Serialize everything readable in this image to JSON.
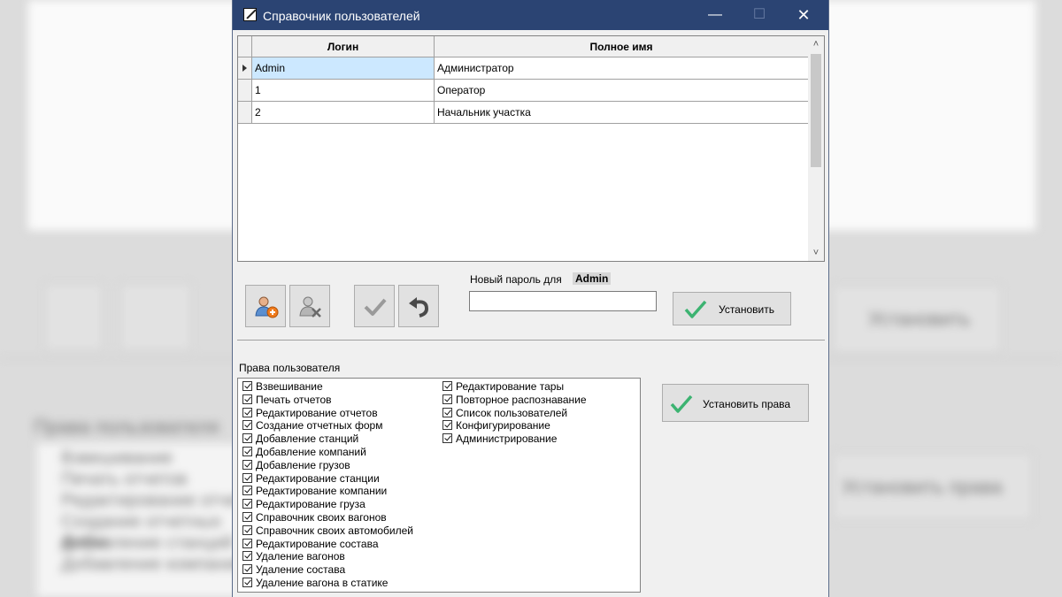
{
  "background": {
    "blurred_texts": [
      "Права пользователя",
      "Установить",
      "Установить права",
      "Взвешивание",
      "Печать отчетов",
      "Редактирование отчетов",
      "Создание отчетных форм",
      "Добавление станций",
      "Добавление компаний"
    ]
  },
  "window": {
    "title": "Справочник пользователей",
    "minimize_glyph": "—",
    "maximize_glyph": "☐",
    "close_glyph": "✕"
  },
  "grid": {
    "columns": [
      "Логин",
      "Полное имя"
    ],
    "rows": [
      {
        "login": "Admin",
        "full_name": "Администратор",
        "selected": true
      },
      {
        "login": "1",
        "full_name": "Оператор",
        "selected": false
      },
      {
        "login": "2",
        "full_name": "Начальник участка",
        "selected": false
      }
    ],
    "scroll_up": "˄",
    "scroll_down": "˅"
  },
  "toolbar": {
    "icons": [
      "add-user-icon",
      "delete-user-icon",
      "confirm-icon",
      "undo-icon"
    ]
  },
  "password": {
    "label": "Новый пароль для",
    "user": "Admin",
    "value": "",
    "set_button": "Установить"
  },
  "rights": {
    "title": "Права пользователя",
    "set_button": "Установить права",
    "left_column": [
      "Взвешивание",
      "Печать отчетов",
      "Редактирование отчетов",
      "Создание отчетных форм",
      "Добавление станций",
      "Добавление компаний",
      "Добавление грузов",
      "Редактирование станции",
      "Редактирование компании",
      "Редактирование груза",
      "Справочник своих вагонов",
      "Справочник своих автомобилей",
      "Редактирование состава",
      "Удаление вагонов",
      "Удаление состава",
      "Удаление вагона в статике"
    ],
    "right_column": [
      "Редактирование тары",
      "Повторное распознавание",
      "Список пользователей",
      "Конфигурирование",
      "Администрирование"
    ]
  },
  "colors": {
    "titlebar": "#2b4473",
    "selection": "#cce8ff",
    "check_green": "#3cb371"
  }
}
